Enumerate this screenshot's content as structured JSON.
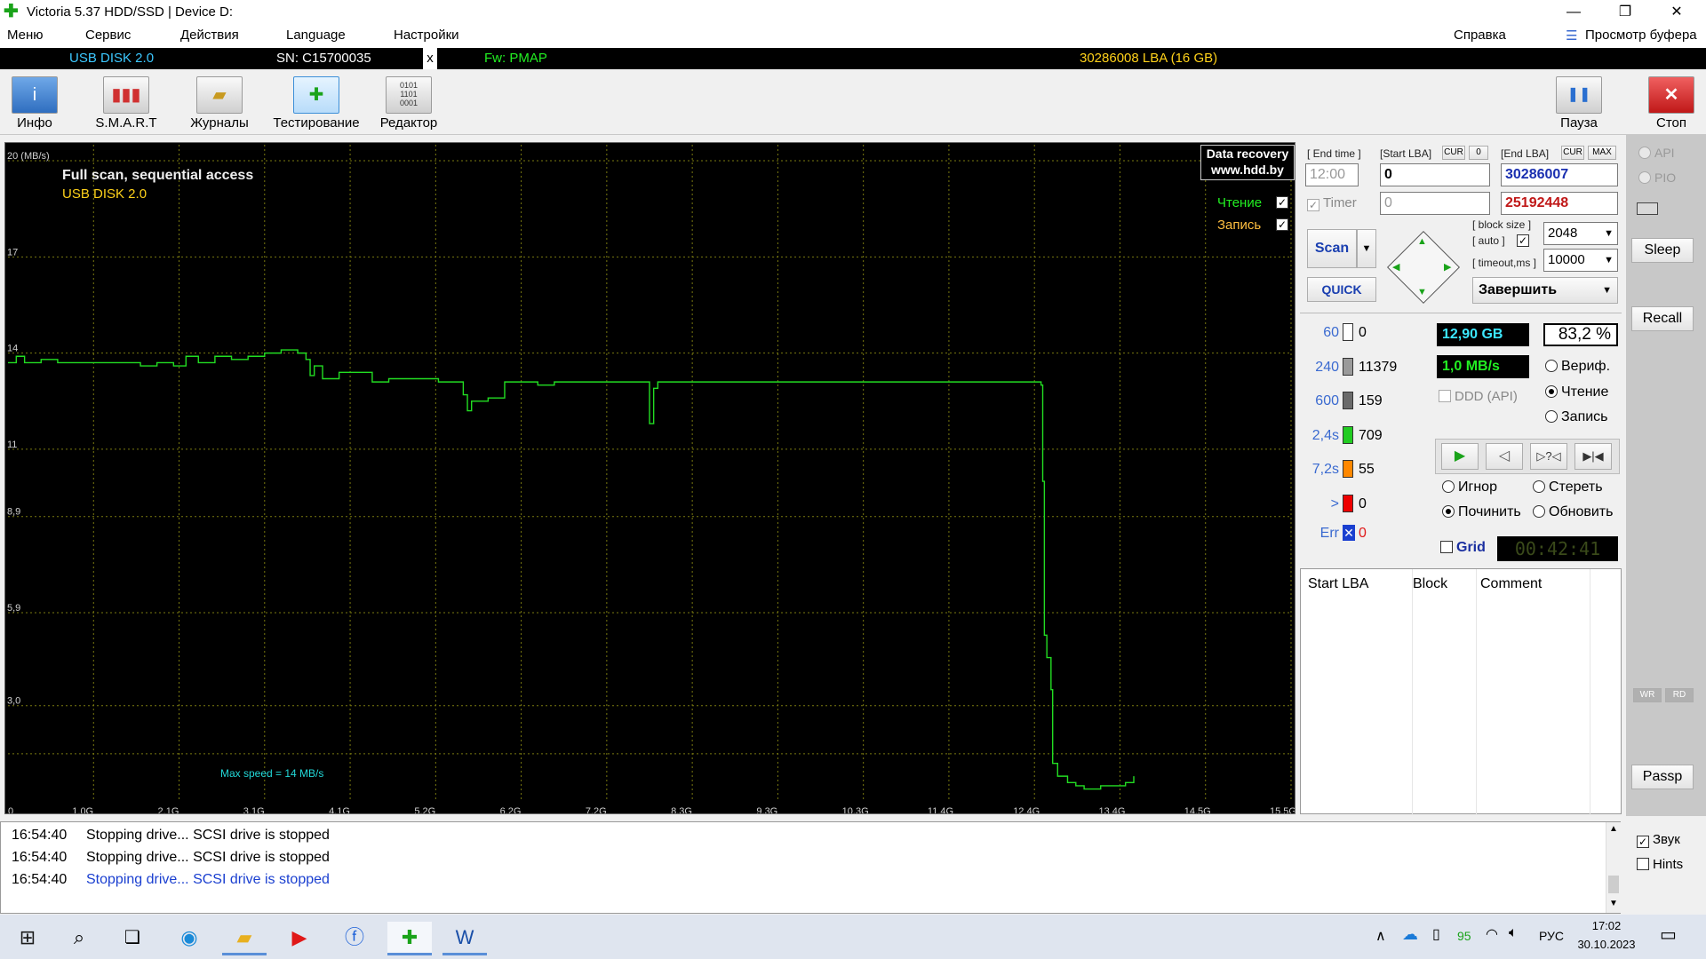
{
  "window": {
    "title": "Victoria 5.37 HDD/SSD | Device D:",
    "minimize": "—",
    "maximize": "❐",
    "close": "✕"
  },
  "menu": {
    "items": [
      "Меню",
      "Сервис",
      "Действия",
      "Language",
      "Настройки"
    ],
    "help": "Справка",
    "buffer": "Просмотр буфера"
  },
  "infobar": {
    "model": "USB DISK 2.0",
    "serial": "SN: C15700035",
    "x": "x",
    "firmware": "Fw: PMAP",
    "capacity": "30286008 LBA (16 GB)"
  },
  "toolbar": {
    "info": "Инфо",
    "smart": "S.M.A.R.T",
    "journals": "Журналы",
    "testing": "Тестирование",
    "editor": "Редактор",
    "pause": "Пауза",
    "stop": "Стоп"
  },
  "graph": {
    "scan_title": "Full scan, sequential access",
    "device": "USB DISK 2.0",
    "badge_line1": "Data recovery",
    "badge_line2": "www.hdd.by",
    "read_label": "Чтение",
    "write_label": "Запись",
    "max_speed": "Max speed = 14 MB/s"
  },
  "chart_data": {
    "type": "line",
    "title": "Full scan, sequential access",
    "ylabel": "(MB/s)",
    "y_ticks": [
      "20 (MB/s)",
      "17",
      "14",
      "11",
      "8,9",
      "5,9",
      "3,0"
    ],
    "x_ticks": [
      "0",
      "1,0G",
      "2,1G",
      "3,1G",
      "4,1G",
      "5,2G",
      "6,2G",
      "7,2G",
      "8,3G",
      "9,3G",
      "10,3G",
      "11,4G",
      "12,4G",
      "13,4G",
      "14,5G",
      "15,5G"
    ],
    "ylim": [
      0,
      20.5
    ],
    "xlim": [
      0,
      15.5
    ],
    "grid": true,
    "series": [
      {
        "name": "Чтение",
        "color": "#22dd22",
        "x": [
          0,
          0.1,
          0.2,
          0.4,
          0.6,
          0.8,
          1.0,
          1.2,
          1.4,
          1.6,
          1.8,
          2.0,
          2.1,
          2.15,
          2.3,
          2.5,
          2.7,
          2.9,
          3.0,
          3.1,
          3.3,
          3.5,
          3.6,
          3.65,
          3.7,
          3.8,
          4.0,
          4.2,
          4.4,
          4.6,
          4.8,
          5.0,
          5.2,
          5.4,
          5.5,
          5.55,
          5.6,
          5.8,
          6.0,
          6.2,
          6.4,
          6.6,
          6.8,
          7.0,
          7.2,
          7.4,
          7.6,
          7.75,
          7.8,
          7.85,
          8.0,
          8.3,
          8.6,
          8.9,
          9.2,
          9.5,
          9.8,
          10.0,
          10.3,
          10.6,
          10.9,
          11.2,
          11.5,
          11.8,
          12.1,
          12.4,
          12.48,
          12.5,
          12.52,
          12.55,
          12.6,
          12.62,
          12.68,
          12.75,
          12.8,
          12.9,
          13.0,
          13.2,
          13.4,
          13.5,
          13.6
        ],
        "y": [
          13.7,
          13.9,
          13.7,
          13.8,
          13.7,
          13.7,
          13.7,
          13.7,
          13.7,
          13.6,
          13.7,
          13.6,
          13.6,
          13.9,
          13.7,
          13.9,
          13.8,
          13.9,
          13.9,
          14.0,
          14.1,
          14.0,
          13.8,
          13.3,
          13.6,
          13.2,
          13.4,
          13.4,
          13.1,
          13.2,
          13.2,
          13.2,
          13.1,
          13.1,
          12.7,
          12.2,
          12.5,
          12.6,
          13.1,
          13.1,
          13.0,
          13.1,
          13.1,
          13.1,
          13.1,
          13.1,
          13.1,
          11.8,
          12.9,
          13.1,
          13.1,
          13.1,
          13.1,
          13.1,
          13.1,
          13.1,
          13.1,
          13.1,
          13.1,
          13.1,
          13.1,
          13.1,
          13.1,
          13.1,
          13.1,
          13.1,
          13.0,
          10.0,
          5.2,
          4.5,
          3.5,
          1.2,
          0.8,
          0.8,
          0.6,
          0.5,
          0.4,
          0.5,
          0.5,
          0.6,
          0.8
        ]
      }
    ]
  },
  "panel": {
    "end_time_label": "[ End time ]",
    "start_lba_label": "[Start LBA]",
    "cur": "CUR",
    "zero": "0",
    "end_lba_label": "[End LBA]",
    "max": "MAX",
    "time_value": "12:00",
    "start_lba": "0",
    "end_lba": "30286007",
    "timer_label": "Timer",
    "timer_value": "0",
    "current_lba": "25192448",
    "block_size_label": "[ block size ]",
    "auto_label": "[ auto ]",
    "timeout_label": "[ timeout,ms ]",
    "block_size": "2048",
    "timeout": "10000",
    "scan": "Scan",
    "quick": "QUICK",
    "finish": "Завершить",
    "stats": [
      {
        "label": "60",
        "value": "0",
        "color": "#ffffff"
      },
      {
        "label": "240",
        "value": "11379",
        "color": "#9a9a9a"
      },
      {
        "label": "600",
        "value": "159",
        "color": "#6a6a6a"
      },
      {
        "label": "2,4s",
        "value": "709",
        "color": "#22cc22"
      },
      {
        "label": "7,2s",
        "value": "55",
        "color": "#ff8800"
      },
      {
        "label": ">",
        "value": "0",
        "color": "#ee0000"
      }
    ],
    "err_label": "Err",
    "err_value": "0",
    "size_done": "12,90 GB",
    "percent": "83,2",
    "percent_sign": "%",
    "speed": "1,0 MB/s",
    "ddd": "DDD (API)",
    "verify": "Вериф.",
    "read": "Чтение",
    "write": "Запись",
    "ignore": "Игнор",
    "erase": "Стереть",
    "repair": "Починить",
    "refresh": "Обновить",
    "grid": "Grid",
    "elapsed": "00:42:41",
    "table_headers": [
      "Start LBA",
      "Block",
      "Comment"
    ]
  },
  "side": {
    "api": "API",
    "pio": "PIO",
    "sleep": "Sleep",
    "recall": "Recall",
    "wr": "WR",
    "rd": "RD",
    "passp": "Passp",
    "sound": "Звук",
    "hints": "Hints"
  },
  "log": [
    {
      "time": "16:54:40",
      "text": "Stopping drive... SCSI drive is stopped",
      "color": "#000000"
    },
    {
      "time": "16:54:40",
      "text": "Stopping drive... SCSI drive is stopped",
      "color": "#000000"
    },
    {
      "time": "16:54:40",
      "text": "Stopping drive... SCSI drive is stopped",
      "color": "#1a3fd0"
    }
  ],
  "taskbar": {
    "battery": "95",
    "lang": "РУС",
    "time": "17:02",
    "date": "30.10.2023"
  }
}
